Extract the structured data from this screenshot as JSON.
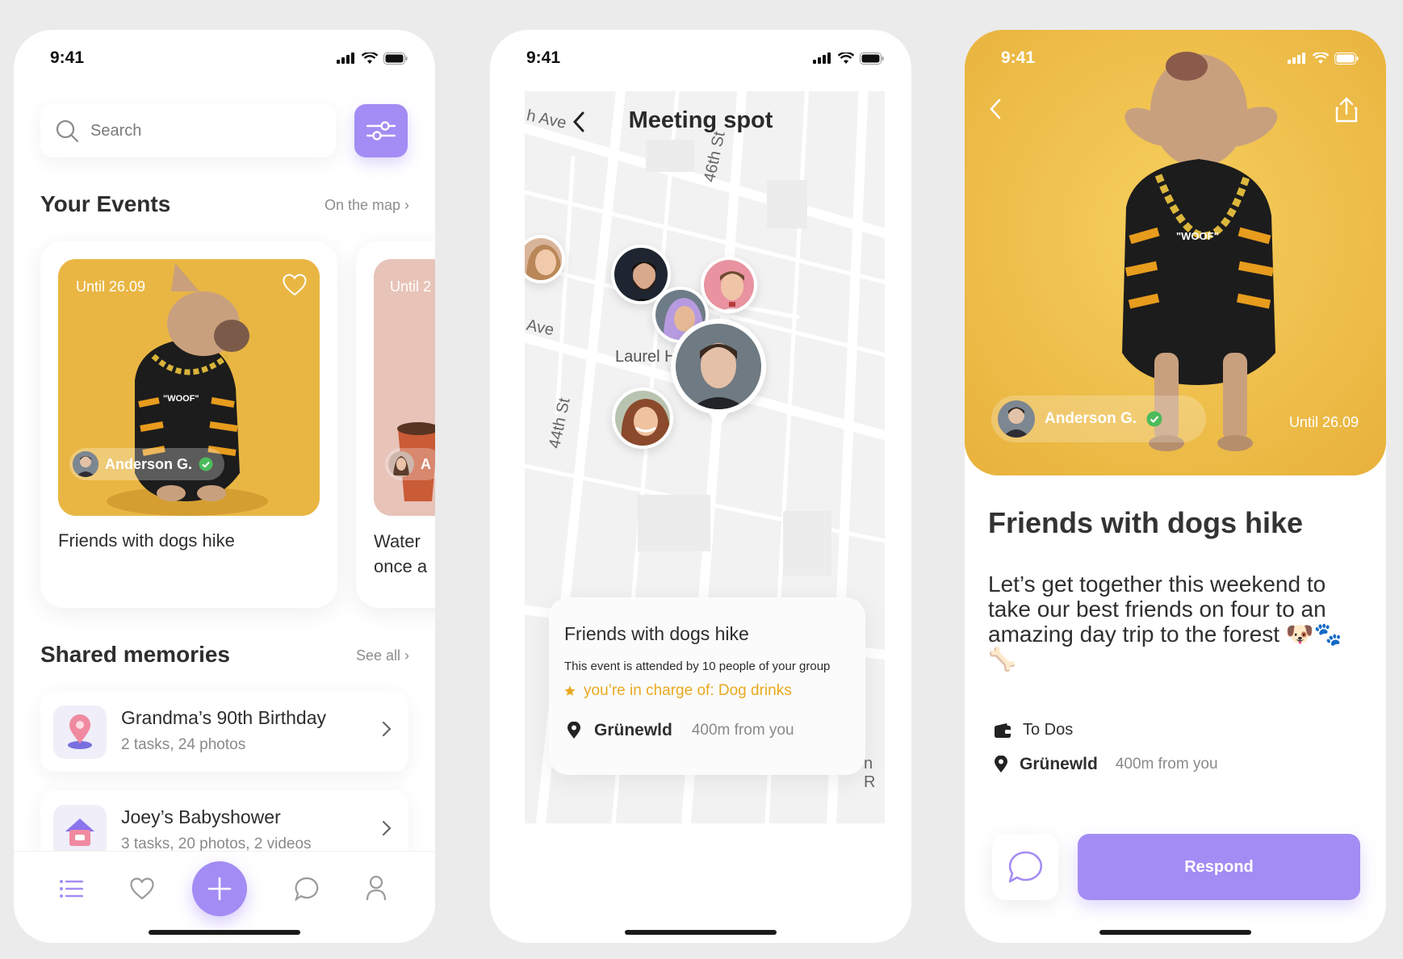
{
  "status": {
    "time": "9:41"
  },
  "events_screen": {
    "search": {
      "placeholder": "Search"
    },
    "your_events": {
      "title": "Your Events",
      "link": "On the map ›"
    },
    "cards": [
      {
        "until": "Until 26.09",
        "author": "Anderson G.",
        "title": "Friends with dogs hike"
      },
      {
        "until": "Until 2",
        "author": "A",
        "title_line1": "Water",
        "title_line2": "once a"
      }
    ],
    "shared_memories": {
      "title": "Shared memories",
      "link": "See all ›"
    },
    "memories": [
      {
        "title": "Grandma’s 90th Birthday",
        "subtitle": "2 tasks, 24 photos",
        "icon": "map-pin-icon"
      },
      {
        "title": "Joey’s Babyshower",
        "subtitle": "3 tasks, 20 photos, 2 videos",
        "icon": "house-icon"
      }
    ],
    "tabbar": [
      "list-icon",
      "heart-icon",
      "plus-icon",
      "chat-icon",
      "profile-icon"
    ]
  },
  "map_screen": {
    "title": "Meeting spot",
    "streets": [
      "h Ave",
      "46th St",
      "Ave",
      "Laurel Hi",
      "44th St",
      "n R"
    ],
    "card": {
      "title": "Friends with dogs hike",
      "subtitle": "This event is attended by 10 people of your group",
      "charge": "you’re in charge of: Dog drinks",
      "location": "Grünewld",
      "distance": "400m from you"
    }
  },
  "detail_screen": {
    "author": "Anderson G.",
    "until": "Until 26.09",
    "title": "Friends with dogs hike",
    "description": "Let’s get together this weekend to take our best friends on four to an amazing day trip to the forest 🐶🐾🦴",
    "todos": "To Dos",
    "location": "Grünewld",
    "distance": "400m from you",
    "respond": "Respond"
  },
  "colors": {
    "accent": "#a38cf4",
    "yellow": "#f0c04c",
    "charge": "#e9a91f",
    "verified": "#4cbb5b"
  }
}
